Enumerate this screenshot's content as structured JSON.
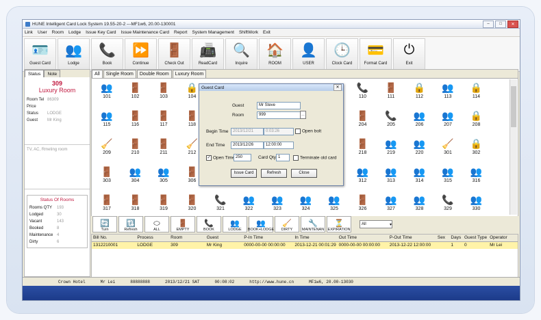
{
  "title": "HUNE Intelligent Card Lock System 19.55-20-2 ---MF1w6, 20.00-130001",
  "menu": [
    "Link",
    "User",
    "Room",
    "Lodge",
    "Issue Key Card",
    "Issue Maintenance Card",
    "Report",
    "System Management",
    "ShiftWork",
    "Exit"
  ],
  "toolbar": [
    {
      "label": "Guest Card",
      "icon": "guest-card-icon"
    },
    {
      "label": "Lodge",
      "icon": "lodge-icon"
    },
    {
      "label": "Book",
      "icon": "book-icon"
    },
    {
      "label": "Continue",
      "icon": "continue-icon"
    },
    {
      "label": "Check Out",
      "icon": "check-out-icon"
    },
    {
      "label": "ReadCard",
      "icon": "read-card-icon"
    },
    {
      "label": "Inquire",
      "icon": "inquire-icon"
    },
    {
      "label": "ROOM",
      "icon": "room-icon"
    },
    {
      "label": "USER",
      "icon": "user-icon"
    },
    {
      "label": "Clock Card",
      "icon": "clock-card-icon"
    },
    {
      "label": "Format Card",
      "icon": "format-card-icon"
    },
    {
      "label": "Exit",
      "icon": "exit-icon"
    }
  ],
  "left": {
    "tabs": [
      "Status",
      "Note"
    ],
    "room_no": "309",
    "room_type": "Luxury Room",
    "room_tel_label": "Room Tel",
    "room_tel": "86309",
    "price_label": "Price",
    "status_label": "Status",
    "status": "LODGE",
    "guest_label": "Guest",
    "guest": "Mr King",
    "amenities": "TV, AC, Rmeting room",
    "stats_title": "Status Of Rooms",
    "stats": [
      {
        "k": "Rooms QTY",
        "v": "193"
      },
      {
        "k": "Lodged",
        "v": "30"
      },
      {
        "k": "Vacant",
        "v": "143"
      },
      {
        "k": "Booked",
        "v": "8"
      },
      {
        "k": "Maintenance",
        "v": "4"
      },
      {
        "k": "Dirty",
        "v": "6"
      }
    ]
  },
  "main_tabs": [
    "All",
    "Single Room",
    "Double Room",
    "Luxury Room"
  ],
  "rooms": [
    {
      "no": "101",
      "s": "guest"
    },
    {
      "no": "102",
      "s": "door"
    },
    {
      "no": "103",
      "s": "door"
    },
    {
      "no": "104",
      "s": "maint"
    },
    {
      "no": "110",
      "s": "book"
    },
    {
      "no": "111",
      "s": "door"
    },
    {
      "no": "112",
      "s": "maint"
    },
    {
      "no": "113",
      "s": "guest"
    },
    {
      "no": "114",
      "s": "maint"
    },
    {
      "no": "115",
      "s": "guest"
    },
    {
      "no": "116",
      "s": "door"
    },
    {
      "no": "117",
      "s": "door"
    },
    {
      "no": "118",
      "s": "door"
    },
    {
      "no": "204",
      "s": "door"
    },
    {
      "no": "205",
      "s": "book"
    },
    {
      "no": "206",
      "s": "guest"
    },
    {
      "no": "207",
      "s": "guest"
    },
    {
      "no": "208",
      "s": "maint"
    },
    {
      "no": "209",
      "s": "dirty"
    },
    {
      "no": "210",
      "s": "door"
    },
    {
      "no": "211",
      "s": "door"
    },
    {
      "no": "212",
      "s": "dirty"
    },
    {
      "no": "218",
      "s": "door"
    },
    {
      "no": "219",
      "s": "guest"
    },
    {
      "no": "220",
      "s": "guest"
    },
    {
      "no": "301",
      "s": "dirty"
    },
    {
      "no": "302",
      "s": "maint"
    },
    {
      "no": "303",
      "s": "door"
    },
    {
      "no": "304",
      "s": "guest"
    },
    {
      "no": "305",
      "s": "guest"
    },
    {
      "no": "306",
      "s": "door"
    },
    {
      "no": "312",
      "s": "guest"
    },
    {
      "no": "313",
      "s": "guest"
    },
    {
      "no": "314",
      "s": "guest"
    },
    {
      "no": "315",
      "s": "guest"
    },
    {
      "no": "316",
      "s": "guest"
    },
    {
      "no": "317",
      "s": "door"
    },
    {
      "no": "318",
      "s": "door"
    },
    {
      "no": "319",
      "s": "door"
    },
    {
      "no": "320",
      "s": "door"
    },
    {
      "no": "321",
      "s": "book"
    },
    {
      "no": "322",
      "s": "guest"
    },
    {
      "no": "323",
      "s": "guest"
    },
    {
      "no": "324",
      "s": "guest"
    },
    {
      "no": "325",
      "s": "guest"
    },
    {
      "no": "326",
      "s": "door"
    },
    {
      "no": "327",
      "s": "guest"
    },
    {
      "no": "328",
      "s": "guest"
    },
    {
      "no": "329",
      "s": "book"
    },
    {
      "no": "330",
      "s": "guest"
    }
  ],
  "filters": [
    "Turn",
    "Refresh",
    "ALL",
    "EMPTY",
    "BOOK",
    "LODGE",
    "BOOK+LODGE",
    "DIRTY",
    "MAINTENAN",
    "EXPIRATION"
  ],
  "filter_select": "All",
  "table": {
    "headers": [
      "Bill No.",
      "Process",
      "Room",
      "Guest",
      "P-In Time",
      "In Time",
      "Out Time",
      "P-Out Time",
      "Sex",
      "Days",
      "Guest Type",
      "Operator"
    ],
    "rows": [
      [
        "1312210001",
        "LODGE",
        "309",
        "Mr King",
        "0000-00-00 00:00:00",
        "2013-12-21 00:01:29",
        "0000-00-00 00:00:00",
        "2013-12-22 12:00:00",
        "",
        "1",
        "0",
        "Mr Lei"
      ]
    ]
  },
  "status_bar": [
    "Crown Hotel",
    "Mr Lei",
    "88888888",
    "2013/12/21  SAT",
    "00:08:02",
    "http://www.hune.cn",
    "MF1w6, 20.00-13030"
  ],
  "dialog": {
    "title": "Guest Card",
    "guest_label": "Guest",
    "guest": "Mr Steve",
    "room_label": "Room",
    "room": "999",
    "begin_label": "Begin Time",
    "begin_date": "2013/12/21",
    "begin_time": "0:03:26",
    "open_bolt": "Open bolt",
    "end_label": "End Time",
    "end_date": "2013/12/26",
    "end_time": "12:00:00",
    "open_times_label": "Open Times",
    "open_times": "250",
    "card_qty_label": "Card Qty",
    "card_qty": "1",
    "terminate": "Terminate old card",
    "btn_issue": "Issue Card",
    "btn_refresh": "Refresh",
    "btn_close": "Close"
  }
}
